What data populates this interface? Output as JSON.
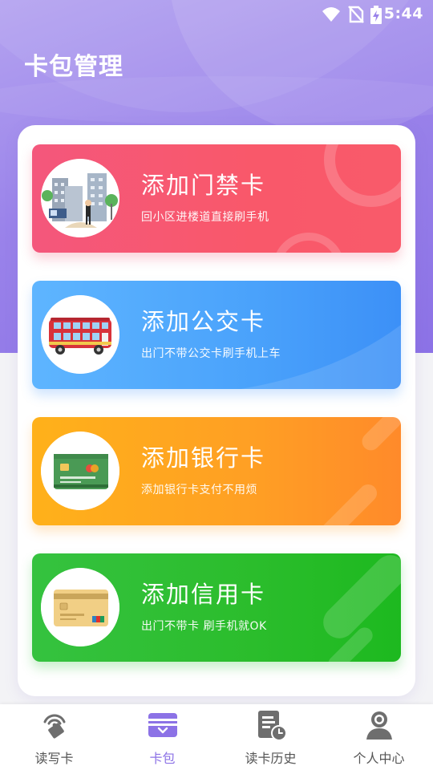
{
  "status_bar": {
    "time": "5:44"
  },
  "header": {
    "title": "卡包管理"
  },
  "cards": [
    {
      "title": "添加门禁卡",
      "subtitle": "回小区进楼道直接刷手机",
      "icon": "building-access-icon"
    },
    {
      "title": "添加公交卡",
      "subtitle": "出门不带公交卡刷手机上车",
      "icon": "bus-icon"
    },
    {
      "title": "添加银行卡",
      "subtitle": "添加银行卡支付不用烦",
      "icon": "bank-card-icon"
    },
    {
      "title": "添加信用卡",
      "subtitle": "出门不带卡 刷手机就OK",
      "icon": "credit-card-icon"
    }
  ],
  "tabbar": {
    "items": [
      {
        "label": "读写卡",
        "icon": "nfc-read-icon"
      },
      {
        "label": "卡包",
        "icon": "wallet-icon",
        "active": true
      },
      {
        "label": "读卡历史",
        "icon": "history-doc-icon"
      },
      {
        "label": "个人中心",
        "icon": "profile-icon"
      }
    ]
  },
  "colors": {
    "accent": "#8c72e6",
    "card_access": "#f9586a",
    "card_bus": "#4aa2fb",
    "card_bank": "#ff9f24",
    "card_credit": "#2bbd2c"
  }
}
